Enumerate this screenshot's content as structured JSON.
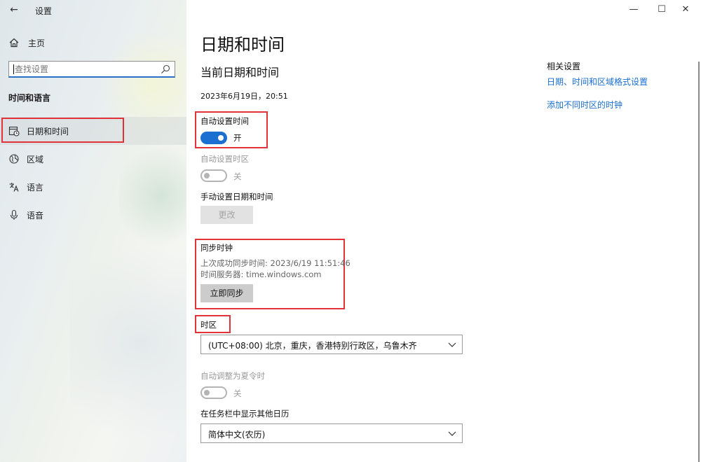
{
  "window": {
    "title": "设置",
    "back_icon": "←",
    "minimize_icon": "—",
    "maximize_icon": "☐",
    "close_icon": "✕"
  },
  "sidebar": {
    "home_label": "主页",
    "search_placeholder": "查找设置",
    "section_title": "时间和语言",
    "items": [
      {
        "label": "日期和时间",
        "icon": "calendar-clock-icon",
        "active": true
      },
      {
        "label": "区域",
        "icon": "globe-icon",
        "active": false
      },
      {
        "label": "语言",
        "icon": "language-icon",
        "active": false
      },
      {
        "label": "语音",
        "icon": "microphone-icon",
        "active": false
      }
    ]
  },
  "main": {
    "page_title": "日期和时间",
    "current_section_title": "当前日期和时间",
    "current_datetime": "2023年6月19日，20:51",
    "auto_time": {
      "label": "自动设置时间",
      "state": "开",
      "on": true
    },
    "auto_timezone": {
      "label": "自动设置时区",
      "state": "关",
      "on": false,
      "disabled": true
    },
    "manual": {
      "label": "手动设置日期和时间",
      "button": "更改"
    },
    "sync": {
      "label": "同步时钟",
      "last_sync": "上次成功同步时间: 2023/6/19 11:51:46",
      "server": "时间服务器: time.windows.com",
      "button": "立即同步"
    },
    "timezone": {
      "label": "时区",
      "value": "(UTC+08:00) 北京，重庆，香港特别行政区，乌鲁木齐"
    },
    "dst": {
      "label": "自动调整为夏令时",
      "state": "关",
      "on": false,
      "disabled": true
    },
    "calendar": {
      "label": "在任务栏中显示其他日历",
      "value": "简体中文(农历)"
    }
  },
  "related": {
    "title": "相关设置",
    "links": [
      "日期、时间和区域格式设置",
      "添加不同时区的时钟"
    ]
  },
  "colors": {
    "accent": "#1a6fd1",
    "highlight_box": "#e0343a"
  }
}
